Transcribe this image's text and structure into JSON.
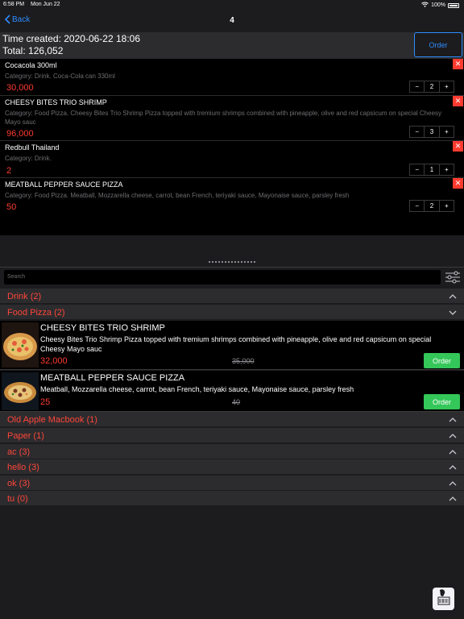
{
  "status": {
    "time": "6:58 PM",
    "date": "Mon Jun 22",
    "battery": "100%"
  },
  "nav": {
    "back_label": "Back",
    "title": "4"
  },
  "summary": {
    "time_created": "Time created: 2020-06-22 18:06",
    "total": "Total: 126,052",
    "order_label": "Order"
  },
  "cart": {
    "items": [
      {
        "name": "Cocacola 300ml",
        "category": "Category: Drink. Coca-Cola can 330ml",
        "price": "30,000",
        "qty": "2"
      },
      {
        "name": "CHEESY BITES TRIO SHRIMP",
        "category": "Category: Food Pizza. Cheesy Bites Trio Shrimp Pizza topped with tremium shrimps combined with pineapple, olive and red capsicum on special Cheesy Mayo sauc",
        "price": "96,000",
        "qty": "3"
      },
      {
        "name": "Redbull Thailand",
        "category": "Category: Drink.",
        "price": "2",
        "qty": "1"
      },
      {
        "name": "MEATBALL PEPPER SAUCE PIZZA",
        "category": "Category: Food Pizza. Meatball, Mozzarella cheese, carrot, bean French, teriyaki sauce, Mayonaise sauce, parsley fresh",
        "price": "50",
        "qty": "2"
      }
    ],
    "minus": "−",
    "plus": "+",
    "delete": "✕"
  },
  "search": {
    "placeholder": "Search"
  },
  "sections": {
    "drink": "Drink (2)",
    "food_pizza": "Food Pizza (2)",
    "old_apple": "Old Apple Macbook (1)",
    "paper": "Paper (1)",
    "ac": "ac (3)",
    "hello": "hello (3)",
    "ok": "ok (3)",
    "tu": "tu (0)"
  },
  "products": [
    {
      "name": "CHEESY BITES TRIO SHRIMP",
      "desc": "Cheesy Bites Trio Shrimp Pizza topped with tremium shrimps combined with pineapple, olive and red capsicum on special Cheesy Mayo sauc",
      "price": "32,000",
      "old_price": "35,000",
      "order_label": "Order"
    },
    {
      "name": "MEATBALL PEPPER SAUCE PIZZA",
      "desc": "Meatball, Mozzarella cheese, carrot, bean French, teriyaki sauce, Mayonaise sauce, parsley fresh",
      "price": "25",
      "old_price": "40",
      "order_label": "Order"
    }
  ],
  "colors": {
    "accent": "#2e8cff",
    "danger": "#ff3b30",
    "success": "#34c759",
    "section_text": "#ff453a"
  }
}
